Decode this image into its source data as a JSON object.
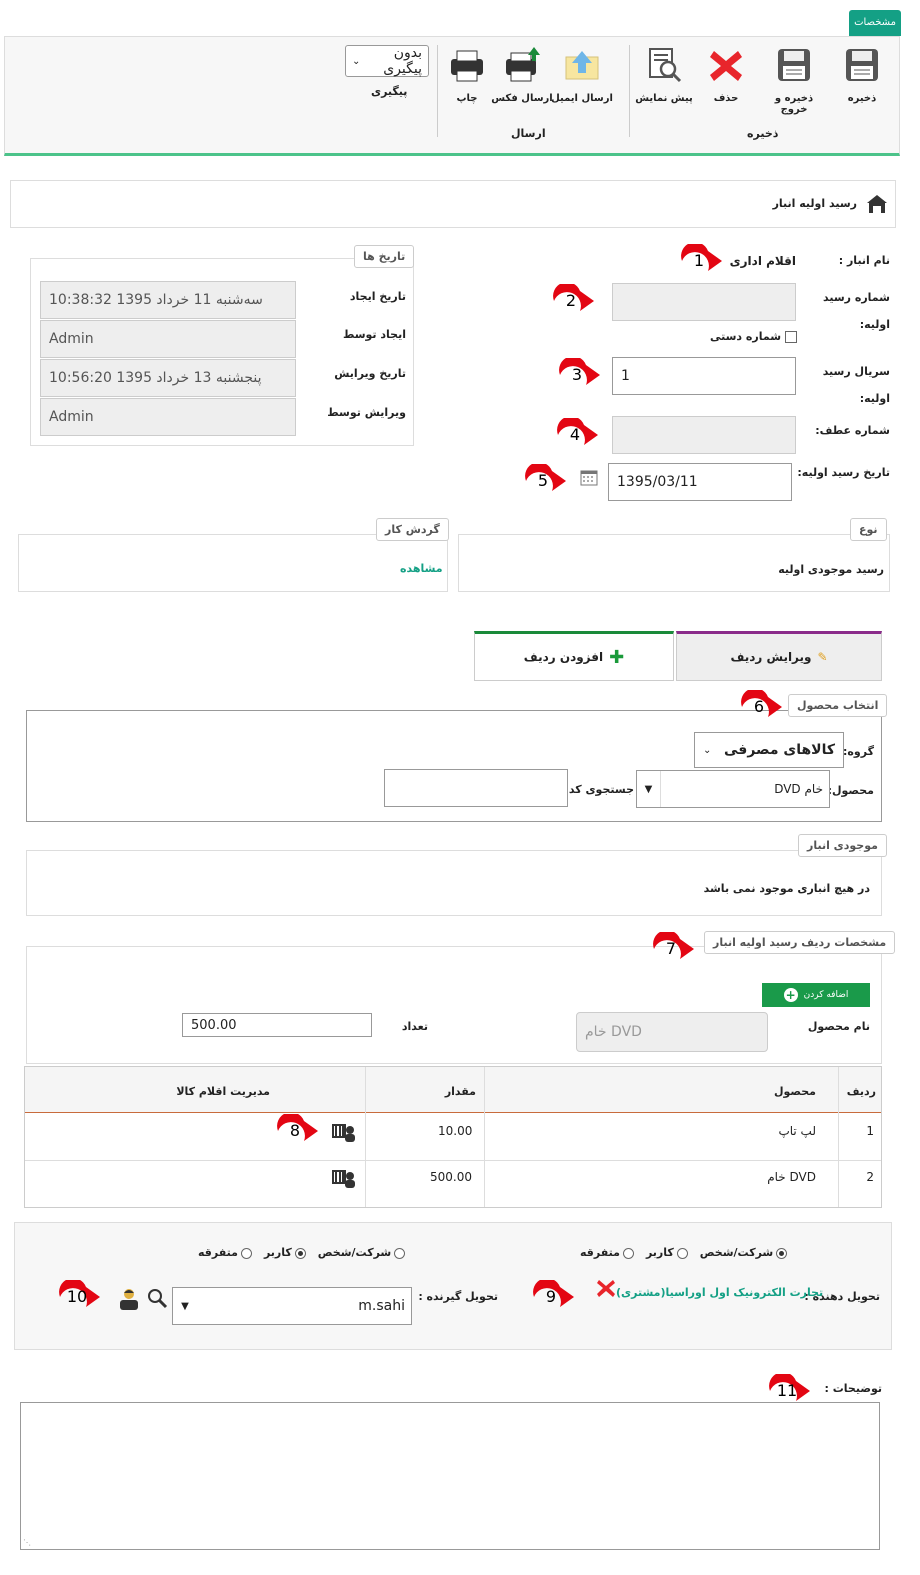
{
  "ribbon": {
    "tab": "مشخصات",
    "save": "ذخیره",
    "save_exit": "ذخیره و خروج",
    "delete": "حذف",
    "preview": "پیش نمایش",
    "send_email": "ارسال ایمیل",
    "send_fax": "ارسال فکس",
    "print": "چاپ",
    "group_save": "ذخیره",
    "group_send": "ارسال",
    "followup_value": "بدون پیگیری",
    "followup_label": "پیگیری"
  },
  "header": {
    "title": "رسید اولیه انبار"
  },
  "form": {
    "warehouse_label": "نام انبار :",
    "warehouse_value": "اقلام اداری",
    "receipt_no_label_1": "شماره رسید",
    "receipt_no_label_2": "اولیه:",
    "manual_no_label": "شماره دستی",
    "serial_label_1": "سریال رسید",
    "serial_label_2": "اولیه:",
    "serial_value": "1",
    "ref_no_label": "شماره عطف:",
    "date_label": "تاریخ رسید اولیه:",
    "date_value": "1395/03/11"
  },
  "dates": {
    "legend": "تاریخ ها",
    "created_label": "تاریخ ایجاد",
    "created_value": "سه‌شنبه 11 خرداد 1395 10:38:32",
    "created_by_label": "ایجاد توسط",
    "created_by_value": "Admin",
    "edited_label": "تاریخ ویرایش",
    "edited_value": "پنجشنبه 13 خرداد 1395 10:56:20",
    "edited_by_label": "ویرایش توسط",
    "edited_by_value": "Admin"
  },
  "type": {
    "legend": "نوع",
    "value": "رسید موجودی اولیه"
  },
  "workflow": {
    "legend": "گردش کار",
    "link": "مشاهده"
  },
  "tabs": {
    "edit_row": "ویرایش ردیف",
    "add_row": "افزودن ردیف"
  },
  "product_select": {
    "legend": "انتخاب محصول",
    "group_label": "گروه:",
    "group_value": "کالاهای مصرفی",
    "product_label": "محصول:",
    "product_value": "DVD خام",
    "search_label": "جستجوی کد:"
  },
  "stock": {
    "legend": "موجودی انبار",
    "message": "در هیچ انباری موجود نمی باشد"
  },
  "row_details": {
    "legend": "مشخصات ردیف رسید اولیه انبار",
    "add_button": "اضافه کردن",
    "product_name_label": "نام محصول",
    "product_name_value": "DVD خام",
    "qty_label": "تعداد",
    "qty_value": "500.00"
  },
  "table": {
    "headers": [
      "ردیف",
      "محصول",
      "مقدار",
      "مدیریت اقلام کالا"
    ],
    "rows": [
      {
        "idx": "1",
        "product": "لپ تاپ",
        "qty": "10.00"
      },
      {
        "idx": "2",
        "product": "DVD خام",
        "qty": "500.00"
      }
    ]
  },
  "parties": {
    "opt_company": "شرکت/شخص",
    "opt_user": "کاربر",
    "opt_misc": "متفرقه",
    "deliverer_label": "تحویل دهنده :",
    "deliverer_value": "تجارت الکترونیک اول اوراسیا(مشتری)",
    "receiver_label": "تحویل گیرنده :",
    "receiver_value": "m.sahi"
  },
  "notes": {
    "label": "توضیحات :"
  },
  "markers": [
    "1",
    "2",
    "3",
    "4",
    "5",
    "6",
    "7",
    "8",
    "9",
    "10",
    "11"
  ],
  "colors": {
    "accent": "#14a085",
    "green_line": "#4cc38a",
    "marker_red": "#e30613",
    "tab_purple": "#8a2b8a",
    "tab_green": "#1a8a3a"
  }
}
